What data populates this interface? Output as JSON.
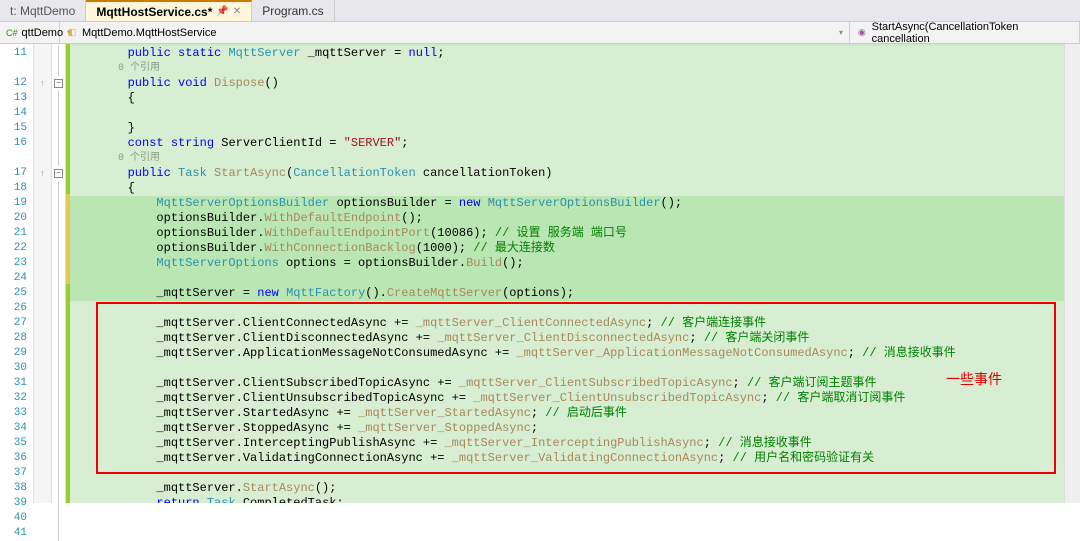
{
  "tabs": {
    "t0": "t: MqttDemo",
    "t1": "MqttHostService.cs*",
    "t2": "Program.cs"
  },
  "nav": {
    "left": "qttDemo",
    "mid": "MqttDemo.MqttHostService",
    "right": "StartAsync(CancellationToken cancellation"
  },
  "gutter": [
    "11",
    "",
    "12",
    "13",
    "14",
    "15",
    "16",
    "",
    "17",
    "18",
    "19",
    "20",
    "21",
    "22",
    "23",
    "24",
    "25",
    "26",
    "27",
    "28",
    "29",
    "30",
    "31",
    "32",
    "33",
    "34",
    "35",
    "36",
    "37",
    "38",
    "39",
    "40",
    "41"
  ],
  "lens": {
    "l1": "0 个引用",
    "l2": "0 个引用"
  },
  "code": {
    "l11a": "public",
    "l11b": "static",
    "l11c": "MqttServer",
    "l11d": " _mqttServer = ",
    "l11e": "null",
    "l11f": ";",
    "l12a": "public",
    "l12b": "void",
    "l12c": "Dispose",
    "l12d": "()",
    "l13": "{",
    "l14": "",
    "l15": "}",
    "l16a": "const",
    "l16b": "string",
    "l16c": " ServerClientId = ",
    "l16d": "\"SERVER\"",
    "l16e": ";",
    "l17a": "public",
    "l17b": "Task",
    "l17c": "StartAsync",
    "l17d": "(",
    "l17e": "CancellationToken",
    "l17f": " cancellationToken)",
    "l18": "{",
    "l19a": "MqttServerOptionsBuilder",
    "l19b": " optionsBuilder = ",
    "l19c": "new",
    "l19d": "MqttServerOptionsBuilder",
    "l19e": "();",
    "l20a": "optionsBuilder.",
    "l20b": "WithDefaultEndpoint",
    "l20c": "();",
    "l21a": "optionsBuilder.",
    "l21b": "WithDefaultEndpointPort",
    "l21c": "(10086); ",
    "l21d": "// 设置 服务端 端口号",
    "l22a": "optionsBuilder.",
    "l22b": "WithConnectionBacklog",
    "l22c": "(1000); ",
    "l22d": "// 最大连接数",
    "l23a": "MqttServerOptions",
    "l23b": " options = optionsBuilder.",
    "l23c": "Build",
    "l23d": "();",
    "l25a": "_mqttServer = ",
    "l25b": "new",
    "l25c": "MqttFactory",
    "l25d": "().",
    "l25e": "CreateMqttServer",
    "l25f": "(options);",
    "l27a": "_mqttServer.ClientConnectedAsync += ",
    "l27b": "_mqttServer_ClientConnectedAsync",
    "l27c": "; ",
    "l27d": "// 客户端连接事件",
    "l28a": "_mqttServer.ClientDisconnectedAsync += ",
    "l28b": "_mqttServer_ClientDisconnectedAsync",
    "l28c": "; ",
    "l28d": "// 客户端关闭事件",
    "l29a": "_mqttServer.ApplicationMessageNotConsumedAsync += ",
    "l29b": "_mqttServer_ApplicationMessageNotConsumedAsync",
    "l29c": "; ",
    "l29d": "// 消息接收事件",
    "l31a": "_mqttServer.ClientSubscribedTopicAsync += ",
    "l31b": "_mqttServer_ClientSubscribedTopicAsync",
    "l31c": "; ",
    "l31d": "// 客户端订阅主题事件",
    "l32a": "_mqttServer.ClientUnsubscribedTopicAsync += ",
    "l32b": "_mqttServer_ClientUnsubscribedTopicAsync",
    "l32c": "; ",
    "l32d": "// 客户端取消订阅事件",
    "l33a": "_mqttServer.StartedAsync += ",
    "l33b": "_mqttServer_StartedAsync",
    "l33c": "; ",
    "l33d": "// 启动后事件",
    "l34a": "_mqttServer.StoppedAsync += ",
    "l34b": "_mqttServer_StoppedAsync",
    "l34c": ";",
    "l35a": "_mqttServer.InterceptingPublishAsync += ",
    "l35b": "_mqttServer_InterceptingPublishAsync",
    "l35c": "; ",
    "l35d": "// 消息接收事件",
    "l36a": "_mqttServer.ValidatingConnectionAsync += ",
    "l36b": "_mqttServer_ValidatingConnectionAsync",
    "l36c": "; ",
    "l36d": "// 用户名和密码验证有关",
    "l38a": "_mqttServer.",
    "l38b": "StartAsync",
    "l38c": "();",
    "l39a": "return",
    "l39b": "Task",
    "l39c": ".CompletedTask;",
    "l40": "}"
  },
  "annotation": "一些事件",
  "fold_glyph_minus": "−"
}
